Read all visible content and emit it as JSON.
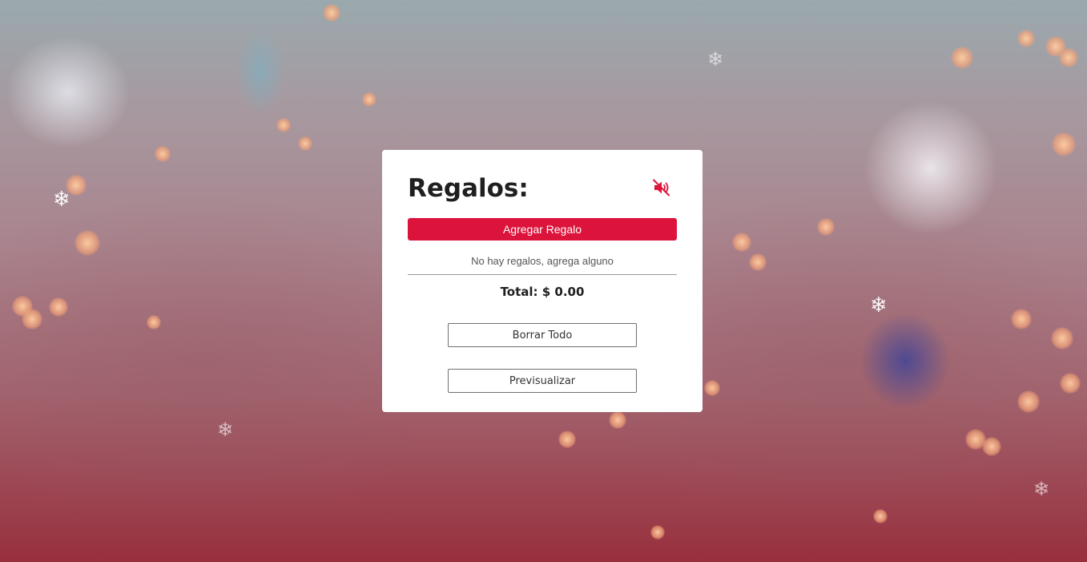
{
  "card": {
    "title": "Regalos:",
    "add_button_label": "Agregar Regalo",
    "empty_message": "No hay regalos, agrega alguno",
    "total_label": "Total: $ 0.00",
    "clear_all_label": "Borrar Todo",
    "preview_label": "Previsualizar",
    "mute_icon": "speaker-muted-icon"
  },
  "background": {
    "snowflake_glyph": "❄"
  },
  "colors": {
    "accent": "#dc143c",
    "card_background": "#ffffff",
    "text": "#1f1f1f"
  }
}
